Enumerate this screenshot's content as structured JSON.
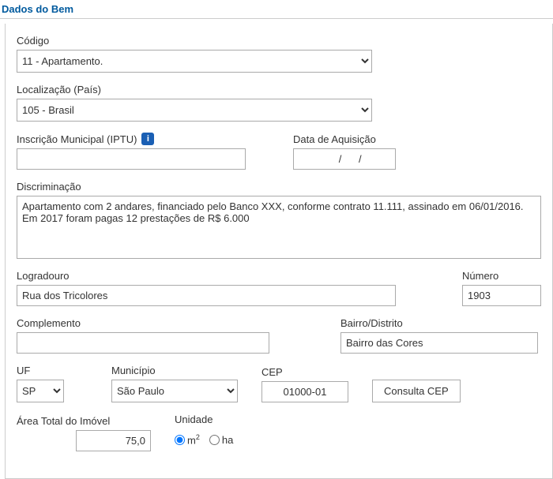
{
  "section": {
    "title": "Dados do Bem"
  },
  "fields": {
    "codigo": {
      "label": "Código",
      "selected": "11 - Apartamento."
    },
    "localizacao": {
      "label": "Localização (País)",
      "selected": "105 - Brasil"
    },
    "inscricao": {
      "label": "Inscrição Municipal (IPTU)",
      "value": ""
    },
    "data_aquisicao": {
      "label": "Data de Aquisição",
      "value": "    /      /"
    },
    "discriminacao": {
      "label": "Discriminação",
      "value": "Apartamento com 2 andares, financiado pelo Banco XXX, conforme contrato 11.111, assinado em 06/01/2016. Em 2017 foram pagas 12 prestações de R$ 6.000"
    },
    "logradouro": {
      "label": "Logradouro",
      "value": "Rua dos Tricolores"
    },
    "numero": {
      "label": "Número",
      "value": "1903"
    },
    "complemento": {
      "label": "Complemento",
      "value": ""
    },
    "bairro": {
      "label": "Bairro/Distrito",
      "value": "Bairro das Cores"
    },
    "uf": {
      "label": "UF",
      "selected": "SP"
    },
    "municipio": {
      "label": "Município",
      "selected": "São Paulo"
    },
    "cep": {
      "label": "CEP",
      "value": "01000-01"
    },
    "consulta_cep": {
      "label": "Consulta CEP"
    },
    "area_total": {
      "label": "Área Total do Imóvel",
      "value": "75,0"
    },
    "unidade": {
      "label": "Unidade",
      "m2": "m",
      "m2_sup": "2",
      "ha": "ha"
    }
  }
}
